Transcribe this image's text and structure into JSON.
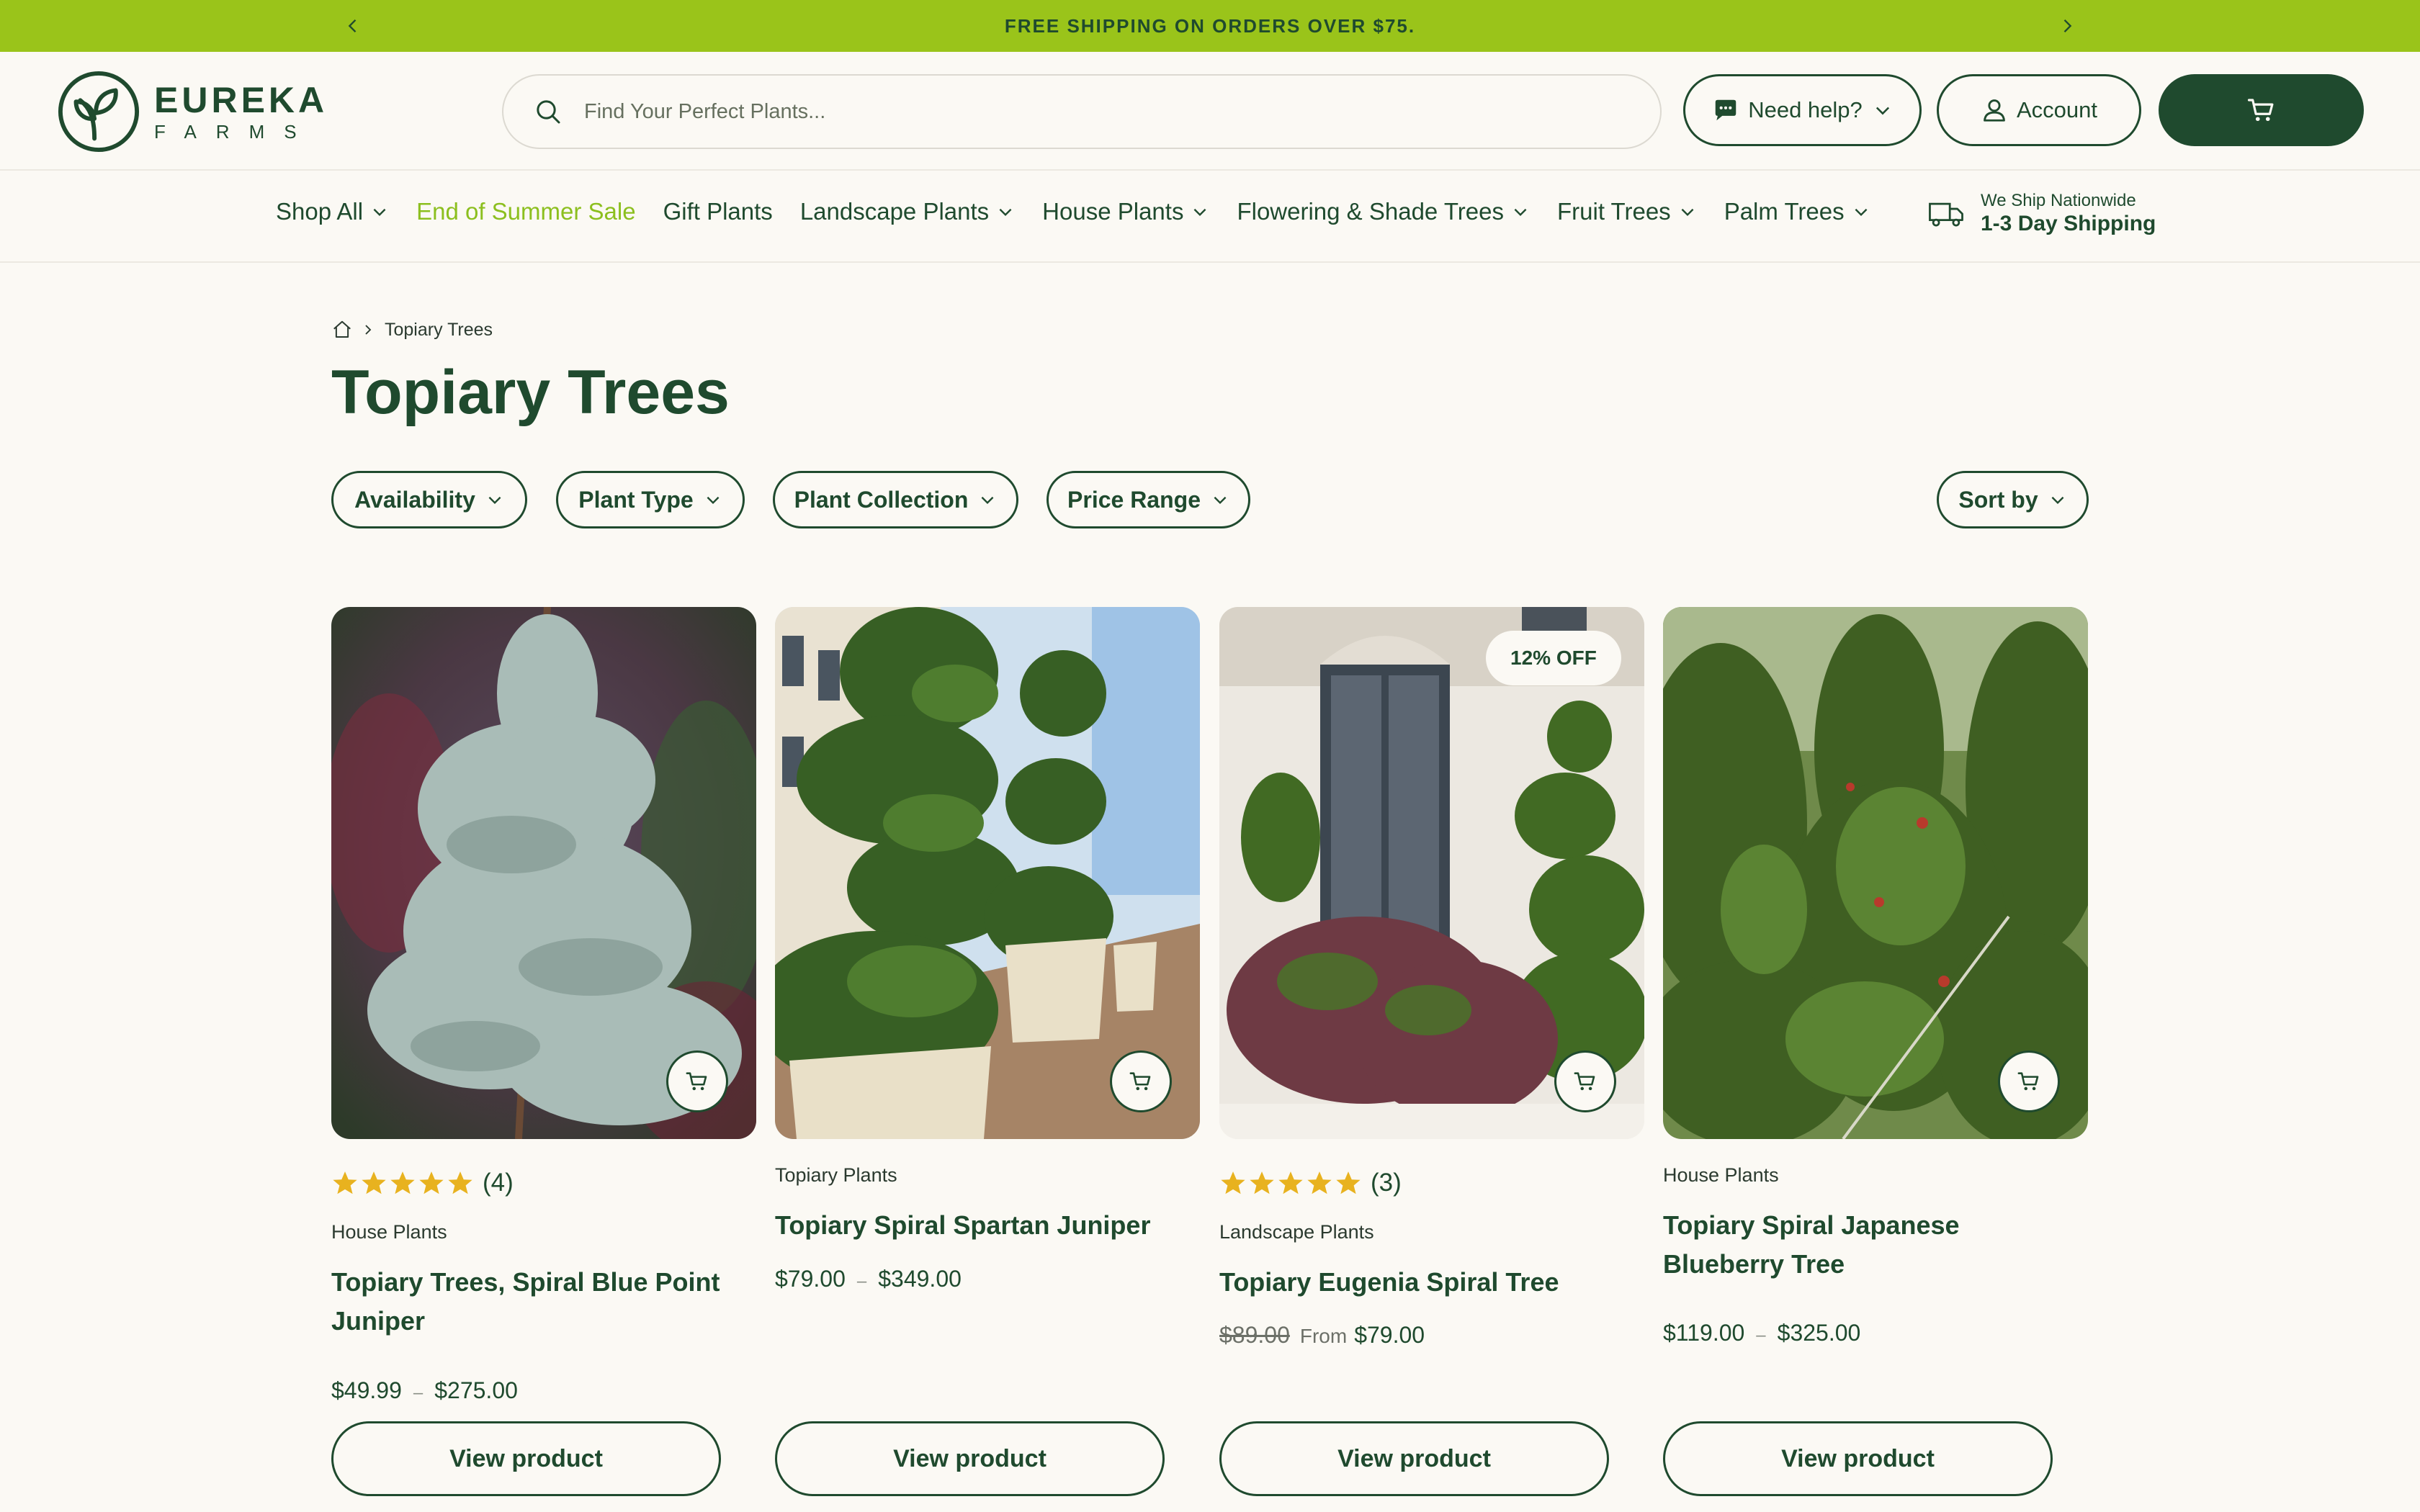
{
  "announcement": {
    "text": "FREE SHIPPING ON ORDERS OVER $75."
  },
  "header": {
    "logo_line1": "EUREKA",
    "logo_line2": "FARMS",
    "search_placeholder": "Find Your Perfect Plants...",
    "help_label": "Need help?",
    "account_label": "Account"
  },
  "nav": {
    "items": [
      {
        "label": "Shop All",
        "dropdown": true
      },
      {
        "label": "End of Summer Sale",
        "dropdown": false
      },
      {
        "label": "Gift Plants",
        "dropdown": false
      },
      {
        "label": "Landscape Plants",
        "dropdown": true
      },
      {
        "label": "House Plants",
        "dropdown": true
      },
      {
        "label": "Flowering & Shade Trees",
        "dropdown": true
      },
      {
        "label": "Fruit Trees",
        "dropdown": true
      },
      {
        "label": "Palm Trees",
        "dropdown": true
      }
    ],
    "shipping_line1": "We Ship Nationwide",
    "shipping_line2": "1-3 Day Shipping"
  },
  "breadcrumb": {
    "current": "Topiary Trees"
  },
  "page_title": "Topiary Trees",
  "filters": {
    "availability": "Availability",
    "plant_type": "Plant Type",
    "plant_collection": "Plant Collection",
    "price_range": "Price Range",
    "sort_by": "Sort by"
  },
  "colors": {
    "brand_green": "#1f4a2e",
    "accent_lime": "#9ac41a",
    "star": "#e8b21f",
    "background": "#fbf9f4"
  },
  "products": [
    {
      "rating_count": "(4)",
      "rating": 5,
      "category": "House Plants",
      "name": "Topiary Trees, Spiral Blue Point Juniper",
      "price_low": "$49.99",
      "price_high": "$275.00",
      "button": "View product"
    },
    {
      "category": "Topiary Plants",
      "name": "Topiary Spiral Spartan Juniper",
      "price_low": "$79.00",
      "price_high": "$349.00",
      "button": "View product"
    },
    {
      "badge": "12% OFF",
      "rating_count": "(3)",
      "rating": 5,
      "category": "Landscape Plants",
      "name": "Topiary Eugenia Spiral Tree",
      "price_old": "$89.00",
      "price_prefix": "From",
      "price_from": "$79.00",
      "button": "View product"
    },
    {
      "category": "House Plants",
      "name": "Topiary Spiral Japanese Blueberry Tree",
      "price_low": "$119.00",
      "price_high": "$325.00",
      "button": "View product"
    }
  ]
}
